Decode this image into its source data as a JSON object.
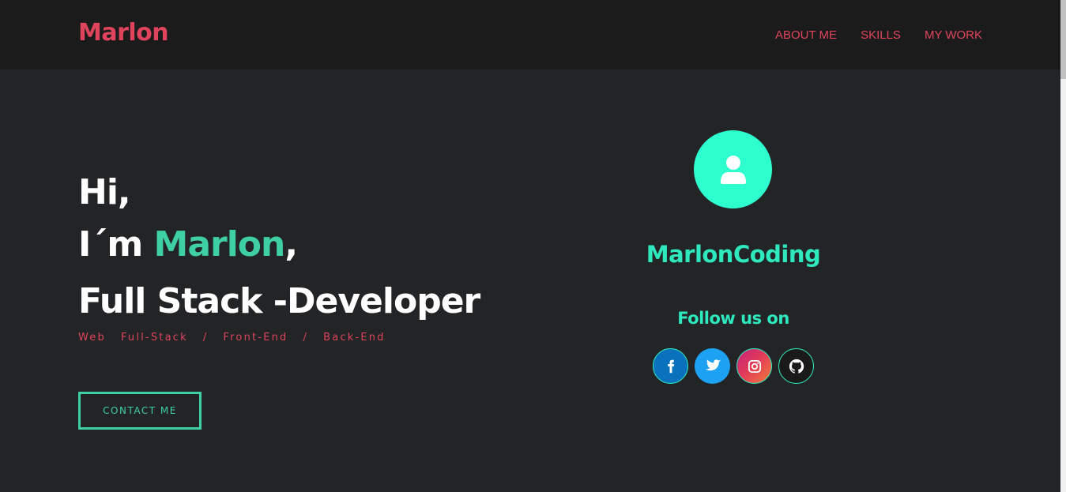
{
  "navbar": {
    "logo": "Marlon",
    "links": [
      {
        "label": "ABOUT ME"
      },
      {
        "label": "SKILLS"
      },
      {
        "label": "MY WORK"
      }
    ]
  },
  "hero": {
    "greeting": "Hi,",
    "intro_prefix": "I´m ",
    "name": "Marlon",
    "intro_suffix": ",",
    "role": "Full Stack -Developer",
    "tagline": "Web   Full-Stack   /   Front-End   /   Back-End",
    "contact_button": "CONTACT ME"
  },
  "profile": {
    "avatar_icon": "user-icon",
    "name": "MarlonCoding",
    "follow_label": "Follow us on",
    "socials": [
      {
        "name": "facebook-icon"
      },
      {
        "name": "twitter-icon"
      },
      {
        "name": "instagram-icon"
      },
      {
        "name": "github-icon"
      }
    ]
  },
  "colors": {
    "brand": "#e0445c",
    "accent": "#3ecfa5",
    "profile_accent": "#2effce",
    "background": "#232426",
    "navbar_background": "#1b1b1c"
  }
}
